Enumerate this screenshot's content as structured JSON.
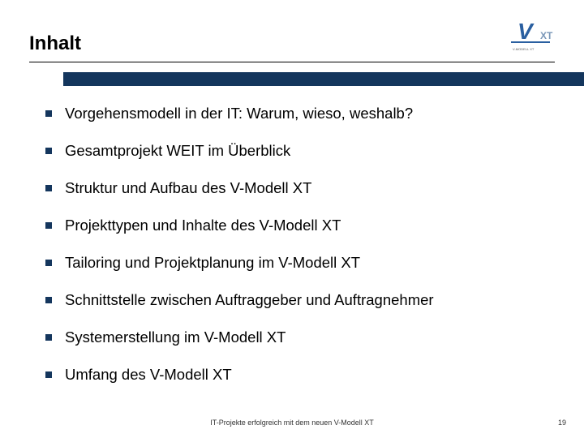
{
  "title": "Inhalt",
  "logo": {
    "primary_text": "V",
    "sub_text": "XT",
    "caption": "V-MODELL XT"
  },
  "bullets": [
    "Vorgehensmodell in der IT: Warum, wieso, weshalb?",
    "Gesamtprojekt WEIT im Überblick",
    "Struktur und Aufbau des V-Modell XT",
    "Projekttypen und Inhalte des V-Modell XT",
    "Tailoring und Projektplanung im V-Modell XT",
    "Schnittstelle zwischen Auftraggeber und Auftragnehmer",
    "Systemerstellung im V-Modell XT",
    "Umfang des V-Modell XT"
  ],
  "footer": "IT-Projekte erfolgreich mit dem neuen V-Modell XT",
  "page_number": "19"
}
